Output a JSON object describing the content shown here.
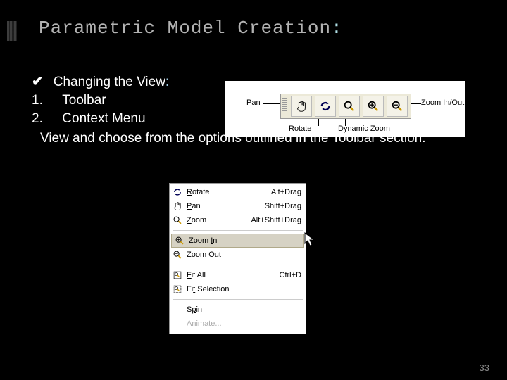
{
  "title": {
    "text": "Parametric Model Creation",
    "colon": ":"
  },
  "bullet": {
    "mark": "✔",
    "label": "Changing the View",
    "colon": ":"
  },
  "list": {
    "item1_num": "1.",
    "item1": "Toolbar",
    "item2_num": "2.",
    "item2": "Context Menu"
  },
  "body": "View and choose from the options outlined in the Toolbar section.",
  "toolbar_fig": {
    "pan": "Pan",
    "rotate": "Rotate",
    "dynzoom": "Dynamic Zoom",
    "zoominout": "Zoom In/Out"
  },
  "context_menu": {
    "rotate": {
      "label": "Rotate",
      "shortcut": "Alt+Drag"
    },
    "pan": {
      "label": "Pan",
      "shortcut": "Shift+Drag"
    },
    "zoom": {
      "label": "Zoom",
      "shortcut": "Alt+Shift+Drag"
    },
    "zoom_in": {
      "label": "Zoom In",
      "shortcut": ""
    },
    "zoom_out": {
      "label": "Zoom Out",
      "shortcut": ""
    },
    "fit_all": {
      "label": "Fit All",
      "shortcut": "Ctrl+D"
    },
    "fit_sel": {
      "label": "Fit Selection",
      "shortcut": ""
    },
    "spin": {
      "label": "Spin",
      "shortcut": ""
    },
    "animate": {
      "label": "Animate...",
      "shortcut": ""
    }
  },
  "page_number": "33"
}
